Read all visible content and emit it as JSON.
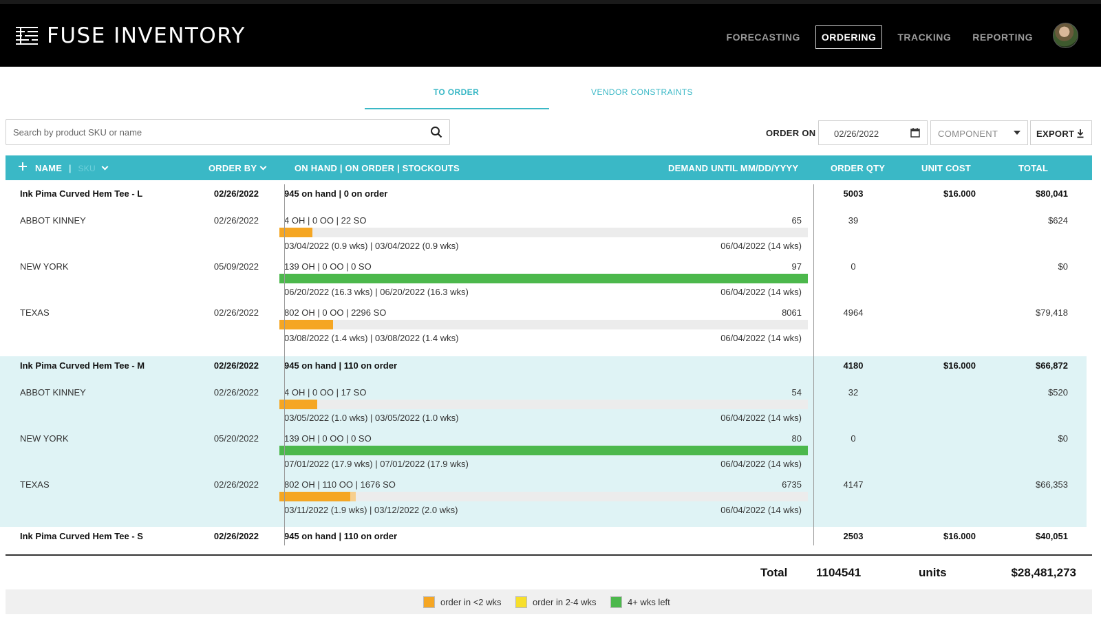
{
  "app": {
    "title": "FUSE INVENTORY",
    "nav": [
      "FORECASTING",
      "ORDERING",
      "TRACKING",
      "REPORTING"
    ],
    "active_nav": "ORDERING"
  },
  "subtabs": [
    "TO ORDER",
    "VENDOR CONSTRAINTS"
  ],
  "toolbar": {
    "search_placeholder": "Search by product SKU or name",
    "order_on_label": "ORDER ON",
    "order_on_date": "02/26/2022",
    "component_label": "COMPONENT",
    "export_label": "EXPORT"
  },
  "columns": {
    "name": "NAME",
    "sep": "|",
    "sku": "SKU",
    "order_by": "ORDER BY",
    "stock": "ON HAND | ON ORDER | STOCKOUTS",
    "demand": "DEMAND UNTIL MM/DD/YYYY",
    "order_qty": "ORDER QTY",
    "unit_cost": "UNIT COST",
    "total": "TOTAL"
  },
  "products": [
    {
      "name": "Ink Pima Curved Hem Tee - L",
      "order_by": "02/26/2022",
      "stock": "945 on hand | 0 on order",
      "order_qty": "5003",
      "unit_cost": "$16.000",
      "total": "$80,041",
      "locations": [
        {
          "name": "ABBOT KINNEY",
          "order_by": "02/26/2022",
          "stock": "4 OH | 0 OO | 22 SO",
          "demand": "65",
          "coverage": 0.062,
          "status": "orange",
          "dates": "03/04/2022 (0.9 wks) | 03/04/2022 (0.9 wks)",
          "until": "06/04/2022 (14 wks)",
          "order_qty": "39",
          "total": "$624"
        },
        {
          "name": "NEW YORK",
          "order_by": "05/09/2022",
          "stock": "139 OH | 0 OO | 0 SO",
          "demand": "97",
          "coverage": 1.0,
          "status": "green",
          "dates": "06/20/2022 (16.3 wks) | 06/20/2022 (16.3 wks)",
          "until": "06/04/2022 (14 wks)",
          "order_qty": "0",
          "total": "$0"
        },
        {
          "name": "TEXAS",
          "order_by": "02/26/2022",
          "stock": "802 OH | 0 OO | 2296 SO",
          "demand": "8061",
          "coverage": 0.102,
          "status": "orange",
          "dates": "03/08/2022 (1.4 wks) | 03/08/2022 (1.4 wks)",
          "until": "06/04/2022 (14 wks)",
          "order_qty": "4964",
          "total": "$79,418"
        }
      ]
    },
    {
      "name": "Ink Pima Curved Hem Tee - M",
      "order_by": "02/26/2022",
      "stock": "945 on hand | 110 on order",
      "order_qty": "4180",
      "unit_cost": "$16.000",
      "total": "$66,872",
      "locations": [
        {
          "name": "ABBOT KINNEY",
          "order_by": "02/26/2022",
          "stock": "4 OH | 0 OO | 17 SO",
          "demand": "54",
          "coverage": 0.071,
          "status": "orange",
          "dates": "03/05/2022 (1.0 wks) | 03/05/2022 (1.0 wks)",
          "until": "06/04/2022 (14 wks)",
          "order_qty": "32",
          "total": "$520"
        },
        {
          "name": "NEW YORK",
          "order_by": "05/20/2022",
          "stock": "139 OH | 0 OO | 0 SO",
          "demand": "80",
          "coverage": 1.0,
          "status": "green",
          "dates": "07/01/2022 (17.9 wks) | 07/01/2022 (17.9 wks)",
          "until": "06/04/2022 (14 wks)",
          "order_qty": "0",
          "total": "$0"
        },
        {
          "name": "TEXAS",
          "order_by": "02/26/2022",
          "stock": "802 OH | 110 OO | 1676 SO",
          "demand": "6735",
          "coverage": 0.134,
          "coverage_ordered": 0.144,
          "status": "orange",
          "dates": "03/11/2022 (1.9 wks) | 03/12/2022 (2.0 wks)",
          "until": "06/04/2022 (14 wks)",
          "order_qty": "4147",
          "total": "$66,353"
        }
      ]
    },
    {
      "name": "Ink Pima Curved Hem Tee - S",
      "order_by": "02/26/2022",
      "stock": "945 on hand | 110 on order",
      "order_qty": "2503",
      "unit_cost": "$16.000",
      "total": "$40,051",
      "locations": []
    }
  ],
  "totals": {
    "label": "Total",
    "qty": "1104541",
    "units": "units",
    "amount": "$28,481,273"
  },
  "legend": [
    {
      "label": "order in <2 wks",
      "color": "#f5a623"
    },
    {
      "label": "order in 2-4 wks",
      "color": "#f7df2b"
    },
    {
      "label": "4+ wks left",
      "color": "#4cb84c"
    }
  ]
}
